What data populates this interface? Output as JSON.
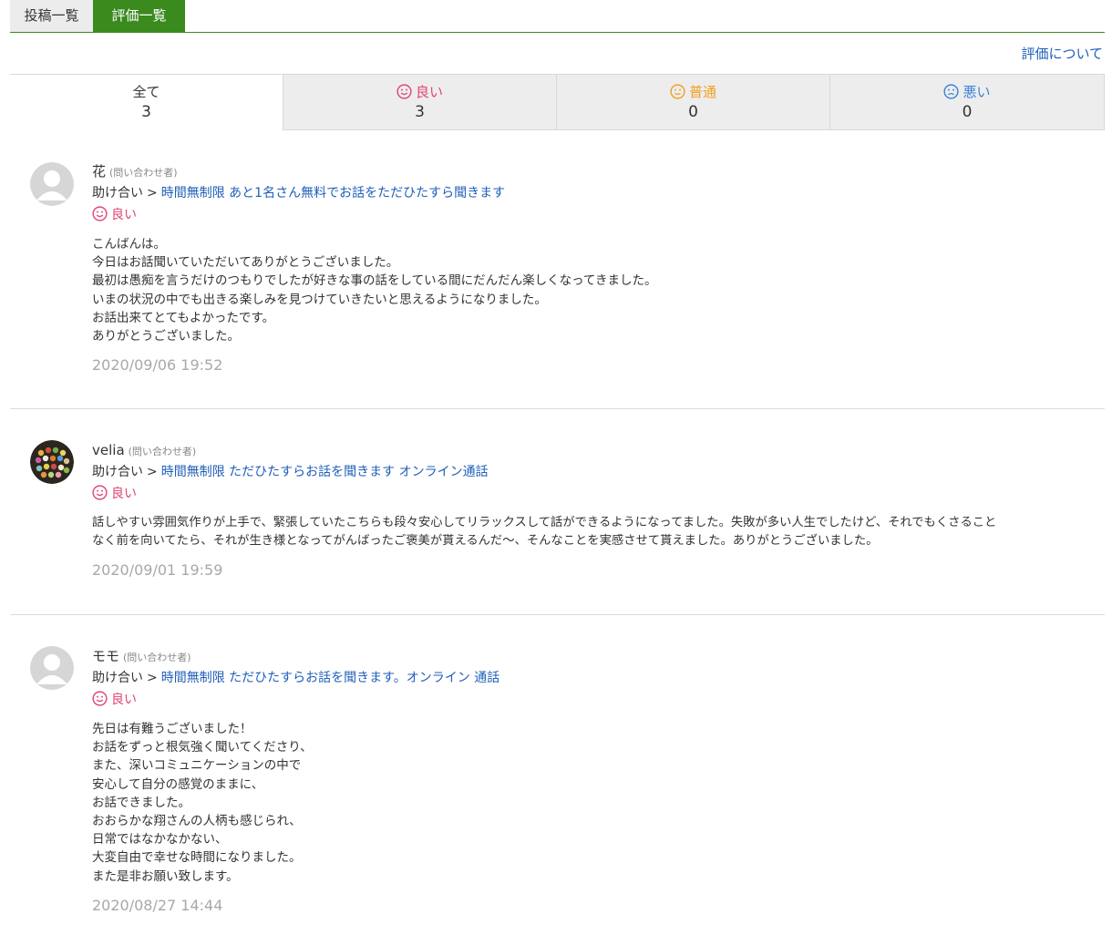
{
  "tabs": {
    "posts": "投稿一覧",
    "reviews": "評価一覧"
  },
  "about_link": "評価について",
  "filters": [
    {
      "label": "全て",
      "count": "3"
    },
    {
      "label": "良い",
      "count": "3"
    },
    {
      "label": "普通",
      "count": "0"
    },
    {
      "label": "悪い",
      "count": "0"
    }
  ],
  "colors": {
    "accent_green": "#3a8a1e",
    "good": "#e24573",
    "normal": "#f0a020",
    "bad": "#3b82d6",
    "link": "#1f5fb8"
  },
  "reviews": [
    {
      "name": "花",
      "role": "(問い合わせ者)",
      "avatar": "default-person-icon",
      "category": "助け合い",
      "separator": ">",
      "service": "時間無制限 あと1名さん無料でお話をただひたすら聞きます",
      "rating": "良い",
      "comment": "こんばんは。\n今日はお話聞いていただいてありがとうございました。\n最初は愚痴を言うだけのつもりでしたが好きな事の話をしている間にだんだん楽しくなってきました。\nいまの状況の中でも出きる楽しみを見つけていきたいと思えるようになりました。\nお話出来てとてもよかったです。\nありがとうございました。",
      "date": "2020/09/06 19:52"
    },
    {
      "name": "velia",
      "role": "(問い合わせ者)",
      "avatar": "colorful-dots-photo",
      "category": "助け合い",
      "separator": ">",
      "service": "時間無制限 ただひたすらお話を聞きます オンライン通話",
      "rating": "良い",
      "comment": "話しやすい雰囲気作りが上手で、緊張していたこちらも段々安心してリラックスして話ができるようになってました。失敗が多い人生でしたけど、それでもくさること\nなく前を向いてたら、それが生き様となってがんばったご褒美が貰えるんだ〜、そんなことを実感させて貰えました。ありがとうございました。",
      "date": "2020/09/01 19:59"
    },
    {
      "name": "モモ",
      "role": "(問い合わせ者)",
      "avatar": "default-person-icon",
      "category": "助け合い",
      "separator": ">",
      "service": "時間無制限 ただひたすらお話を聞きます。オンライン 通話",
      "rating": "良い",
      "comment": "先日は有難うございました！\nお話をずっと根気強く聞いてくださり、\nまた、深いコミュニケーションの中で\n安心して自分の感覚のままに、\nお話できました。\nおおらかな翔さんの人柄も感じられ、\n日常ではなかなかない、\n大変自由で幸せな時間になりました。\nまた是非お願い致します。",
      "date": "2020/08/27 14:44"
    }
  ]
}
